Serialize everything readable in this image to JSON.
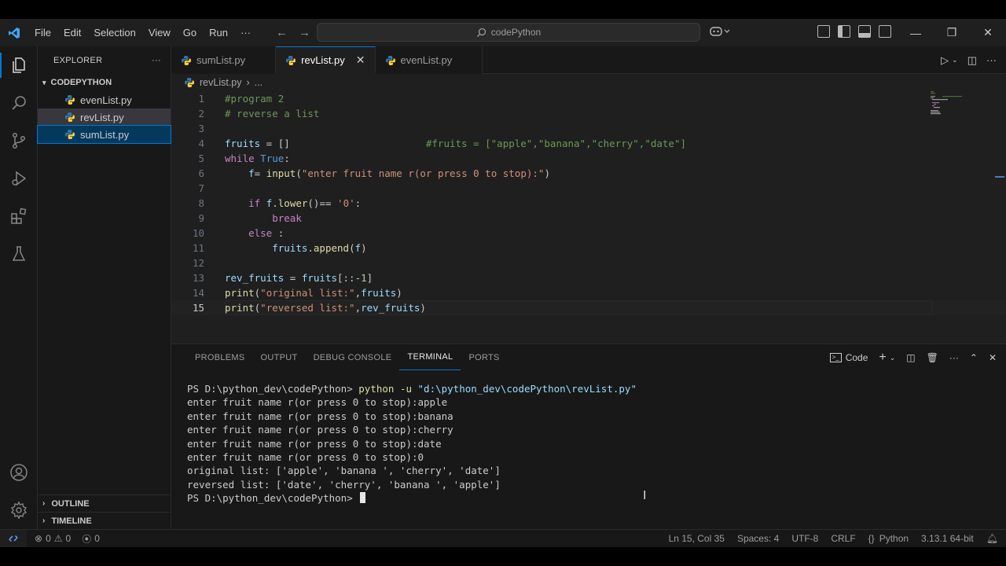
{
  "menu": [
    "File",
    "Edit",
    "Selection",
    "View",
    "Go",
    "Run",
    "···"
  ],
  "command_center": "codePython",
  "sidebar": {
    "title": "EXPLORER",
    "folder": "CODEPYTHON",
    "files": [
      "evenList.py",
      "revList.py",
      "sumList.py"
    ],
    "sections": [
      "OUTLINE",
      "TIMELINE"
    ]
  },
  "tabs": [
    "sumList.py",
    "revList.py",
    "evenList.py"
  ],
  "breadcrumb": {
    "file": "revList.py",
    "rest": "..."
  },
  "code_lines": [
    "#program 2",
    "# reverse a list",
    "",
    "fruits = []                       #fruits = [\"apple\",\"banana\",\"cherry\",\"date\"]",
    "while True:",
    "    f= input(\"enter fruit name r(or press 0 to stop):\")",
    "",
    "    if f.lower()== '0':",
    "        break",
    "    else :",
    "        fruits.append(f)",
    "",
    "rev_fruits = fruits[::-1]",
    "print(\"original list:\",fruits)",
    "print(\"reversed list:\",rev_fruits)"
  ],
  "panel_tabs": [
    "PROBLEMS",
    "OUTPUT",
    "DEBUG CONSOLE",
    "TERMINAL",
    "PORTS"
  ],
  "panel_shell": "Code",
  "terminal": {
    "prompt": "PS D:\\python_dev\\codePython> ",
    "command": "python -u ",
    "command_arg": "\"d:\\python_dev\\codePython\\revList.py\"",
    "output": [
      "enter fruit name r(or press 0 to stop):apple",
      "enter fruit name r(or press 0 to stop):banana",
      "enter fruit name r(or press 0 to stop):cherry",
      "enter fruit name r(or press 0 to stop):date",
      "enter fruit name r(or press 0 to stop):0",
      "original list: ['apple', 'banana ', 'cherry', 'date']",
      "reversed list: ['date', 'cherry', 'banana ', 'apple']"
    ],
    "final_prompt": "PS D:\\python_dev\\codePython> "
  },
  "status": {
    "errors": "0",
    "warnings": "0",
    "ports": "0",
    "position": "Ln 15, Col 35",
    "spaces": "Spaces: 4",
    "encoding": "UTF-8",
    "eol": "CRLF",
    "language": "Python",
    "version": "3.13.1 64-bit"
  },
  "colors": {
    "accent": "#0078d4",
    "python_blue": "#3776ab",
    "python_yellow": "#ffd43b"
  }
}
